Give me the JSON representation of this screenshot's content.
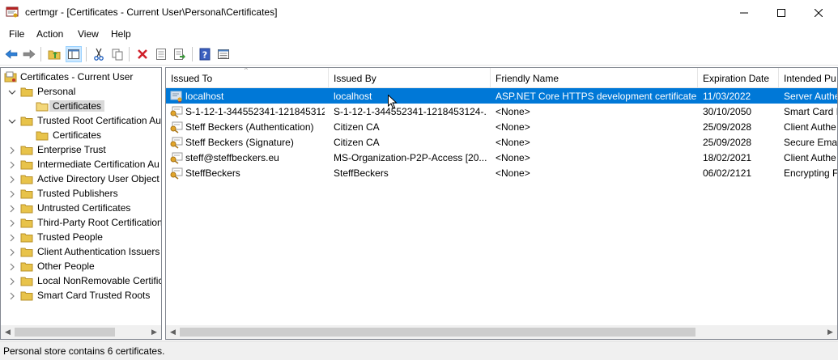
{
  "window": {
    "title": "certmgr - [Certificates - Current User\\Personal\\Certificates]"
  },
  "menu": [
    "File",
    "Action",
    "View",
    "Help"
  ],
  "toolbar": {
    "buttons": [
      "back-arrow-icon",
      "forward-arrow-icon",
      "up-folder-icon",
      "show-hide-tree-icon",
      "cut-icon",
      "copy-icon",
      "delete-icon",
      "properties-icon",
      "export-icon",
      "help-icon",
      "console-icon"
    ]
  },
  "tree": {
    "items": [
      {
        "label": "Certificates - Current User"
      },
      {
        "label": "Personal"
      },
      {
        "label": "Certificates"
      },
      {
        "label": "Trusted Root Certification Au"
      },
      {
        "label": "Certificates"
      },
      {
        "label": "Enterprise Trust"
      },
      {
        "label": "Intermediate Certification Au"
      },
      {
        "label": "Active Directory User Object"
      },
      {
        "label": "Trusted Publishers"
      },
      {
        "label": "Untrusted Certificates"
      },
      {
        "label": "Third-Party Root Certification"
      },
      {
        "label": "Trusted People"
      },
      {
        "label": "Client Authentication Issuers"
      },
      {
        "label": "Other People"
      },
      {
        "label": "Local NonRemovable Certific"
      },
      {
        "label": "Smart Card Trusted Roots"
      }
    ]
  },
  "list": {
    "columns": [
      "Issued To",
      "Issued By",
      "Friendly Name",
      "Expiration Date",
      "Intended Pu"
    ],
    "rows": [
      {
        "issued_to": "localhost",
        "issued_by": "localhost",
        "friendly_name": "ASP.NET Core HTTPS development certificate",
        "expiration": "11/03/2022",
        "purpose": "Server Authe"
      },
      {
        "issued_to": "S-1-12-1-344552341-121845312...",
        "issued_by": "S-1-12-1-344552341-1218453124-...",
        "friendly_name": "<None>",
        "expiration": "30/10/2050",
        "purpose": "Smart Card I"
      },
      {
        "issued_to": "Steff Beckers (Authentication)",
        "issued_by": "Citizen CA",
        "friendly_name": "<None>",
        "expiration": "25/09/2028",
        "purpose": "Client Authe"
      },
      {
        "issued_to": "Steff Beckers (Signature)",
        "issued_by": "Citizen CA",
        "friendly_name": "<None>",
        "expiration": "25/09/2028",
        "purpose": "Secure Emai"
      },
      {
        "issued_to": "steff@steffbeckers.eu",
        "issued_by": "MS-Organization-P2P-Access [20...",
        "friendly_name": "<None>",
        "expiration": "18/02/2021",
        "purpose": "Client Authe"
      },
      {
        "issued_to": "SteffBeckers",
        "issued_by": "SteffBeckers",
        "friendly_name": "<None>",
        "expiration": "06/02/2121",
        "purpose": "Encrypting F"
      }
    ]
  },
  "status": {
    "text": "Personal store contains 6 certificates."
  },
  "colors": {
    "selection": "#0078d7",
    "folder": "#e8c34a"
  }
}
